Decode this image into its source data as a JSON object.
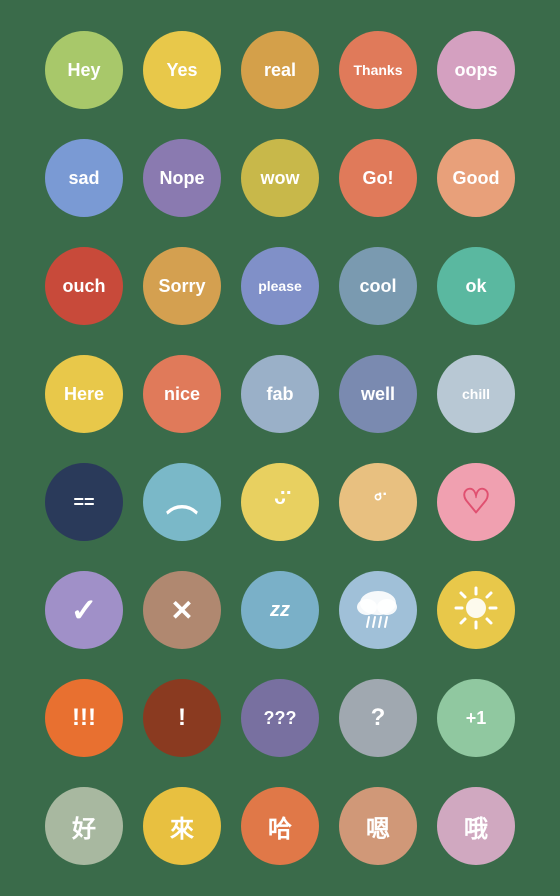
{
  "circles": [
    {
      "label": "Hey",
      "bg": "#a8c86a",
      "type": "text"
    },
    {
      "label": "Yes",
      "bg": "#e8c84a",
      "type": "text"
    },
    {
      "label": "real",
      "bg": "#d4a04a",
      "type": "text"
    },
    {
      "label": "Thanks",
      "bg": "#e07a5a",
      "type": "text",
      "size": "small"
    },
    {
      "label": "oops",
      "bg": "#d4a0c0",
      "type": "text"
    },
    {
      "label": "sad",
      "bg": "#7a9ad4",
      "type": "text"
    },
    {
      "label": "Nope",
      "bg": "#8a7ab0",
      "type": "text"
    },
    {
      "label": "wow",
      "bg": "#c8b84a",
      "type": "text"
    },
    {
      "label": "Go!",
      "bg": "#e07a5a",
      "type": "text"
    },
    {
      "label": "Good",
      "bg": "#e8a07a",
      "type": "text"
    },
    {
      "label": "ouch",
      "bg": "#c84a3a",
      "type": "text"
    },
    {
      "label": "Sorry",
      "bg": "#d4a050",
      "type": "text"
    },
    {
      "label": "please",
      "bg": "#8090c8",
      "type": "text",
      "size": "small"
    },
    {
      "label": "cool",
      "bg": "#7a9ab0",
      "type": "text"
    },
    {
      "label": "ok",
      "bg": "#5ab8a0",
      "type": "text"
    },
    {
      "label": "Here",
      "bg": "#e8c84a",
      "type": "text"
    },
    {
      "label": "nice",
      "bg": "#e07a5a",
      "type": "text"
    },
    {
      "label": "fab",
      "bg": "#9ab0c8",
      "type": "text"
    },
    {
      "label": "well",
      "bg": "#7a8ab0",
      "type": "text"
    },
    {
      "label": "chill",
      "bg": "#b8c8d4",
      "type": "text",
      "size": "small"
    },
    {
      "label": "==",
      "bg": "#2a3a5a",
      "type": "symbol"
    },
    {
      "label": "frown",
      "bg": "#7ab8c8",
      "type": "face-sad"
    },
    {
      "label": "smile",
      "bg": "#e8d060",
      "type": "face-happy"
    },
    {
      "label": "neutral",
      "bg": "#e8c080",
      "type": "face-neutral"
    },
    {
      "label": "heart",
      "bg": "#f0a0b0",
      "type": "heart"
    },
    {
      "label": "check",
      "bg": "#a090c8",
      "type": "check"
    },
    {
      "label": "x",
      "bg": "#b08870",
      "type": "cross"
    },
    {
      "label": "zzz",
      "bg": "#7ab0c8",
      "type": "zzz"
    },
    {
      "label": "rain",
      "bg": "#a0c0d8",
      "type": "cloud"
    },
    {
      "label": "sun",
      "bg": "#e8c84a",
      "type": "sun"
    },
    {
      "label": "!!!",
      "bg": "#e87030",
      "type": "text",
      "size": "large"
    },
    {
      "label": "!",
      "bg": "#8a3a20",
      "type": "text",
      "size": "large"
    },
    {
      "label": "???",
      "bg": "#7870a0",
      "type": "text"
    },
    {
      "label": "?",
      "bg": "#a0a8b0",
      "type": "text",
      "size": "large"
    },
    {
      "label": "+1",
      "bg": "#90c8a0",
      "type": "text"
    },
    {
      "label": "好",
      "bg": "#a8b8a0",
      "type": "text",
      "size": "large"
    },
    {
      "label": "來",
      "bg": "#e8c040",
      "type": "text",
      "size": "large"
    },
    {
      "label": "哈",
      "bg": "#e07848",
      "type": "text",
      "size": "large"
    },
    {
      "label": "嗯",
      "bg": "#d09878",
      "type": "text",
      "size": "large"
    },
    {
      "label": "哦",
      "bg": "#d0a8c0",
      "type": "text",
      "size": "large"
    }
  ]
}
